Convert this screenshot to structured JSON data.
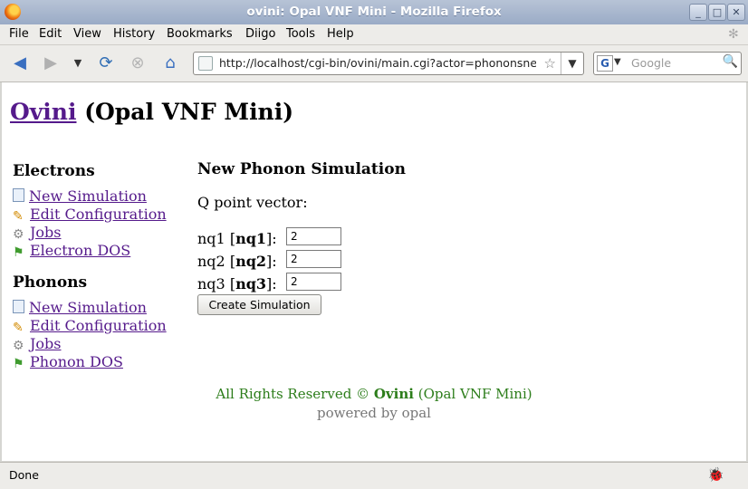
{
  "window": {
    "title": "ovini: Opal VNF Mini - Mozilla Firefox"
  },
  "menu": {
    "items": [
      "File",
      "Edit",
      "View",
      "History",
      "Bookmarks",
      "Diigo",
      "Tools",
      "Help"
    ]
  },
  "toolbar": {
    "url": "http://localhost/cgi-bin/ovini/main.cgi?actor=phononsnew",
    "search_placeholder": "Google",
    "search_engine_letter": "G"
  },
  "page": {
    "site_link": "Ovini",
    "site_subtitle": "(Opal VNF Mini)",
    "sidebar": {
      "sections": [
        {
          "heading": "Electrons",
          "links": [
            {
              "icon": "page-icon",
              "label": "New Simulation"
            },
            {
              "icon": "pencil-icon",
              "label": "Edit Configuration"
            },
            {
              "icon": "gear-icon",
              "label": "Jobs"
            },
            {
              "icon": "flag-icon",
              "label": "Electron DOS"
            }
          ]
        },
        {
          "heading": "Phonons",
          "links": [
            {
              "icon": "page-icon",
              "label": "New Simulation"
            },
            {
              "icon": "pencil-icon",
              "label": "Edit Configuration"
            },
            {
              "icon": "gear-icon",
              "label": "Jobs"
            },
            {
              "icon": "flag-icon",
              "label": "Phonon DOS"
            }
          ]
        }
      ]
    },
    "main": {
      "heading": "New Phonon Simulation",
      "qpoint_label": "Q point vector:",
      "fields": [
        {
          "label": "nq1",
          "bold": "nq1",
          "value": "2"
        },
        {
          "label": "nq2",
          "bold": "nq2",
          "value": "2"
        },
        {
          "label": "nq3",
          "bold": "nq3",
          "value": "2"
        }
      ],
      "submit_label": "Create Simulation"
    },
    "footer": {
      "rights": "All Rights Reserved ©",
      "brand": "Ovini",
      "brand_sub": "(Opal VNF Mini)",
      "powered": "powered by opal"
    }
  },
  "status": {
    "text": "Done"
  },
  "colors": {
    "link": "#551a8b",
    "footer_green": "#2c7d1a",
    "titlebar": "#9aabc6"
  }
}
